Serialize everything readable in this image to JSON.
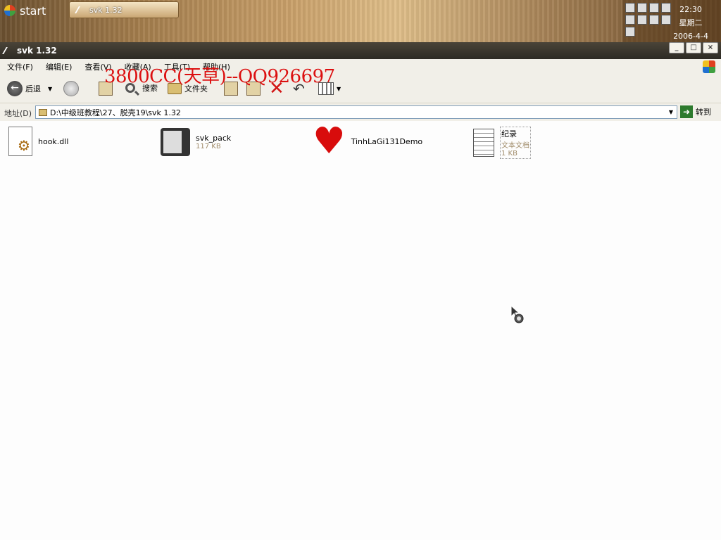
{
  "taskbar": {
    "start_label": "start",
    "task_button_label": "svk 1.32",
    "clock_time": "22:30",
    "clock_day": "星期二",
    "clock_date": "2006-4-4"
  },
  "window": {
    "title": "svk 1.32",
    "minimize": "_",
    "maximize": "□",
    "close": "×"
  },
  "menu": [
    "文件(F)",
    "编辑(E)",
    "查看(V)",
    "收藏(A)",
    "工具(T)",
    "帮助(H)"
  ],
  "watermark": "3800CC(天草)--QQ926697",
  "toolbar": {
    "back_label": "后退",
    "search_label": "搜索",
    "folders_label": "文件夹"
  },
  "address": {
    "label": "地址(D)",
    "value": "D:\\中级班教程\\27、脱壳19\\svk 1.32",
    "go_label": "转到"
  },
  "files": [
    {
      "name": "hook.dll",
      "meta": "",
      "meta2": ""
    },
    {
      "name": "svk_pack",
      "meta": "117 KB",
      "meta2": ""
    },
    {
      "name": "TinhLaGi131Demo",
      "meta": "",
      "meta2": ""
    },
    {
      "name": "纪录",
      "meta": "文本文档",
      "meta2": "1 KB"
    }
  ]
}
